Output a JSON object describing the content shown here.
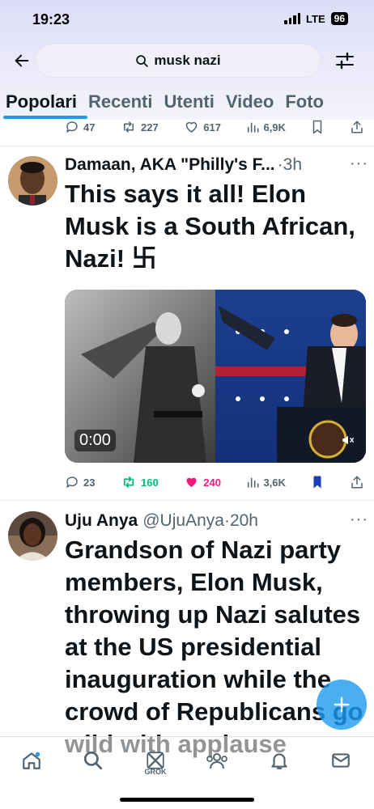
{
  "status_bar": {
    "time": "19:23",
    "network": "LTE",
    "battery": "96"
  },
  "search": {
    "query": "musk nazi"
  },
  "tabs": [
    {
      "label": "Popolari",
      "active": true
    },
    {
      "label": "Recenti",
      "active": false
    },
    {
      "label": "Utenti",
      "active": false
    },
    {
      "label": "Video",
      "active": false
    },
    {
      "label": "Foto",
      "active": false
    }
  ],
  "prev_post_actions": {
    "replies": "47",
    "reposts": "227",
    "likes": "617",
    "views": "6,9K"
  },
  "posts": [
    {
      "author_name": "Damaan, AKA \"Philly's F...",
      "time": "3h",
      "text": "This says it all!  Elon Musk is a South African, Nazi! 卐",
      "video_time": "0:00",
      "replies": "23",
      "reposts": "160",
      "likes": "240",
      "views": "3,6K"
    },
    {
      "author_name": "Uju Anya",
      "handle": "@UjuAnya",
      "time": "20h",
      "text": "Grandson of Nazi party members, Elon Musk, throwing up Nazi salutes at the US presidential inauguration while the crowd of Republicans go wild with applause"
    }
  ],
  "bottom_nav": {
    "grok_label": "GROK"
  },
  "colors": {
    "accent": "#1d9bf0",
    "like": "#f91880",
    "repost": "#00ba7c",
    "bookmark": "#1d3cb8"
  }
}
